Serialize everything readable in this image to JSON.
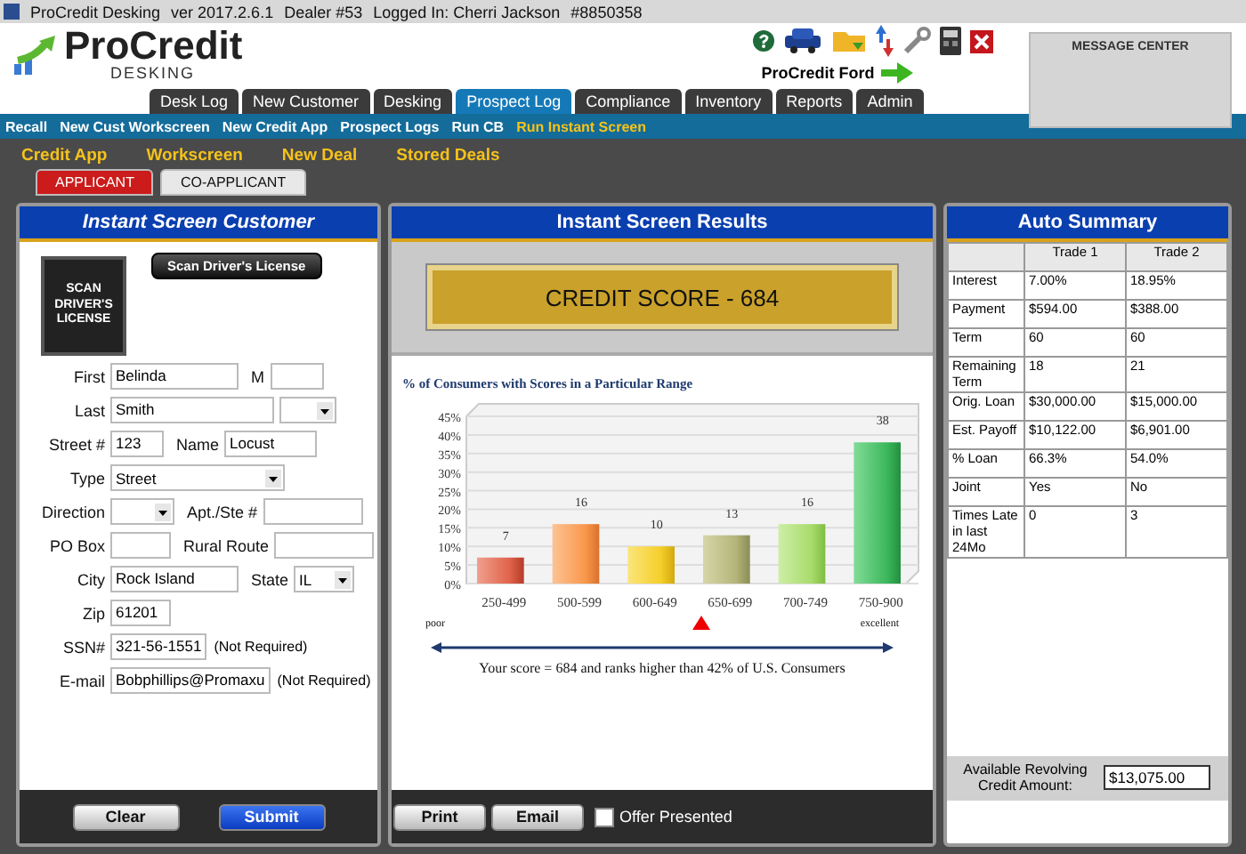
{
  "window": {
    "title": "ProCredit Desking",
    "version": "ver 2017.2.6.1",
    "dealer": "Dealer #53",
    "logged_in": "Logged In: Cherri Jackson",
    "user_id": "#8850358"
  },
  "header": {
    "logo_name": "ProCredit",
    "logo_sub": "DESKING",
    "dealer_name": "ProCredit Ford",
    "message_center": "MESSAGE CENTER"
  },
  "nav_tabs": [
    {
      "label": "Desk Log",
      "selected": false
    },
    {
      "label": "New Customer",
      "selected": false
    },
    {
      "label": "Desking",
      "selected": false
    },
    {
      "label": "Prospect Log",
      "selected": true
    },
    {
      "label": "Compliance",
      "selected": false
    },
    {
      "label": "Inventory",
      "selected": false
    },
    {
      "label": "Reports",
      "selected": false
    },
    {
      "label": "Admin",
      "selected": false
    }
  ],
  "sub_nav": [
    {
      "label": "Recall",
      "selected": false
    },
    {
      "label": "New Cust Workscreen",
      "selected": false
    },
    {
      "label": "New Credit App",
      "selected": false
    },
    {
      "label": "Prospect Logs",
      "selected": false
    },
    {
      "label": "Run CB",
      "selected": false
    },
    {
      "label": "Run Instant Screen",
      "selected": true
    }
  ],
  "action_links": [
    "Credit App",
    "Workscreen",
    "New Deal",
    "Stored Deals"
  ],
  "applicant_tabs": [
    {
      "label": "APPLICANT",
      "selected": true
    },
    {
      "label": "CO-APPLICANT",
      "selected": false
    }
  ],
  "customer_panel": {
    "title": "Instant Screen Customer",
    "scan_button": "Scan Driver's License",
    "scan_logo": [
      "SCAN",
      "DRIVER'S",
      "LICENSE"
    ],
    "rows": [
      {
        "items": [
          {
            "kind": "input",
            "label": "First",
            "value": "Belinda"
          },
          {
            "kind": "input",
            "label": "M"
          }
        ]
      },
      {
        "items": [
          {
            "kind": "input",
            "label": "Last",
            "value": "Smith"
          },
          {
            "kind": "select"
          }
        ]
      },
      {
        "items": [
          {
            "kind": "input",
            "label": "Street #",
            "value": "123"
          },
          {
            "kind": "input",
            "label": "Name",
            "value": "Locust"
          }
        ]
      },
      {
        "items": [
          {
            "kind": "select",
            "label": "Type",
            "value": "Street"
          }
        ]
      },
      {
        "items": [
          {
            "kind": "select",
            "label": "Direction"
          },
          {
            "kind": "input",
            "label": "Apt./Ste #"
          }
        ]
      },
      {
        "items": [
          {
            "kind": "input",
            "label": "PO Box"
          },
          {
            "kind": "input",
            "label": "Rural Route"
          }
        ]
      },
      {
        "items": [
          {
            "kind": "input",
            "label": "City",
            "value": "Rock Island"
          },
          {
            "kind": "select",
            "label": "State",
            "value": "IL"
          }
        ]
      },
      {
        "items": [
          {
            "kind": "input",
            "label": "Zip",
            "value": "61201"
          }
        ]
      },
      {
        "items": [
          {
            "kind": "input",
            "label": "SSN#",
            "value": "321-56-1551",
            "note": "(Not Required)"
          }
        ]
      },
      {
        "items": [
          {
            "kind": "input",
            "label": "E-mail",
            "value": "Bobphillips@Promaxu",
            "note": "(Not Required)"
          }
        ]
      }
    ],
    "buttons": [
      {
        "label": "Clear",
        "kind": "plain"
      },
      {
        "label": "Submit",
        "kind": "primary"
      }
    ]
  },
  "results_panel": {
    "title": "Instant Screen Results",
    "score_banner": "CREDIT SCORE - 684",
    "chart_data": {
      "type": "bar",
      "title": "% of Consumers with Scores in a Particular Range",
      "categories": [
        "250-499",
        "500-599",
        "600-649",
        "650-699",
        "700-749",
        "750-900"
      ],
      "values": [
        7,
        16,
        10,
        13,
        16,
        38
      ],
      "ylim": [
        0,
        45
      ],
      "yticks": [
        {
          "value": 0,
          "label": "0%"
        },
        {
          "value": 5,
          "label": "5%"
        },
        {
          "value": 10,
          "label": "10%"
        },
        {
          "value": 15,
          "label": "15%"
        },
        {
          "value": 20,
          "label": "20%"
        },
        {
          "value": 25,
          "label": "25%"
        },
        {
          "value": 30,
          "label": "30%"
        },
        {
          "value": 35,
          "label": "35%"
        },
        {
          "value": 40,
          "label": "40%"
        },
        {
          "value": 45,
          "label": "45%"
        }
      ],
      "data_labels": true,
      "grid": true
    },
    "scale": {
      "low": "poor",
      "high": "excellent",
      "segments": [
        {
          "selected": false
        },
        {
          "selected": false
        },
        {
          "selected": false
        },
        {
          "selected": true
        },
        {
          "selected": false
        },
        {
          "selected": false
        }
      ]
    },
    "summary": "Your score = 684 and ranks higher than 42% of U.S. Consumers",
    "buttons": [
      "Print",
      "Email"
    ],
    "offer_checkbox": {
      "label": "Offer Presented",
      "checked": false
    }
  },
  "summary_panel": {
    "title": "Auto Summary",
    "columns": [
      "Trade 1",
      "Trade 2"
    ],
    "rows": [
      {
        "label": "Interest",
        "values": [
          "7.00%",
          "18.95%"
        ]
      },
      {
        "label": "Payment",
        "values": [
          "$594.00",
          "$388.00"
        ]
      },
      {
        "label": "Term",
        "values": [
          "60",
          "60"
        ]
      },
      {
        "label": "Remaining Term",
        "values": [
          "18",
          "21"
        ]
      },
      {
        "label": "Orig. Loan",
        "values": [
          "$30,000.00",
          "$15,000.00"
        ]
      },
      {
        "label": "Est. Payoff",
        "values": [
          "$10,122.00",
          "$6,901.00"
        ]
      },
      {
        "label": "% Loan",
        "values": [
          "66.3%",
          "54.0%"
        ]
      },
      {
        "label": "Joint",
        "values": [
          "Yes",
          "No"
        ]
      },
      {
        "label": "Times Late in last 24Mo",
        "values": [
          "0",
          "3"
        ]
      }
    ],
    "revolving_label": "Available Revolving Credit Amount:",
    "revolving_value": "$13,075.00"
  }
}
